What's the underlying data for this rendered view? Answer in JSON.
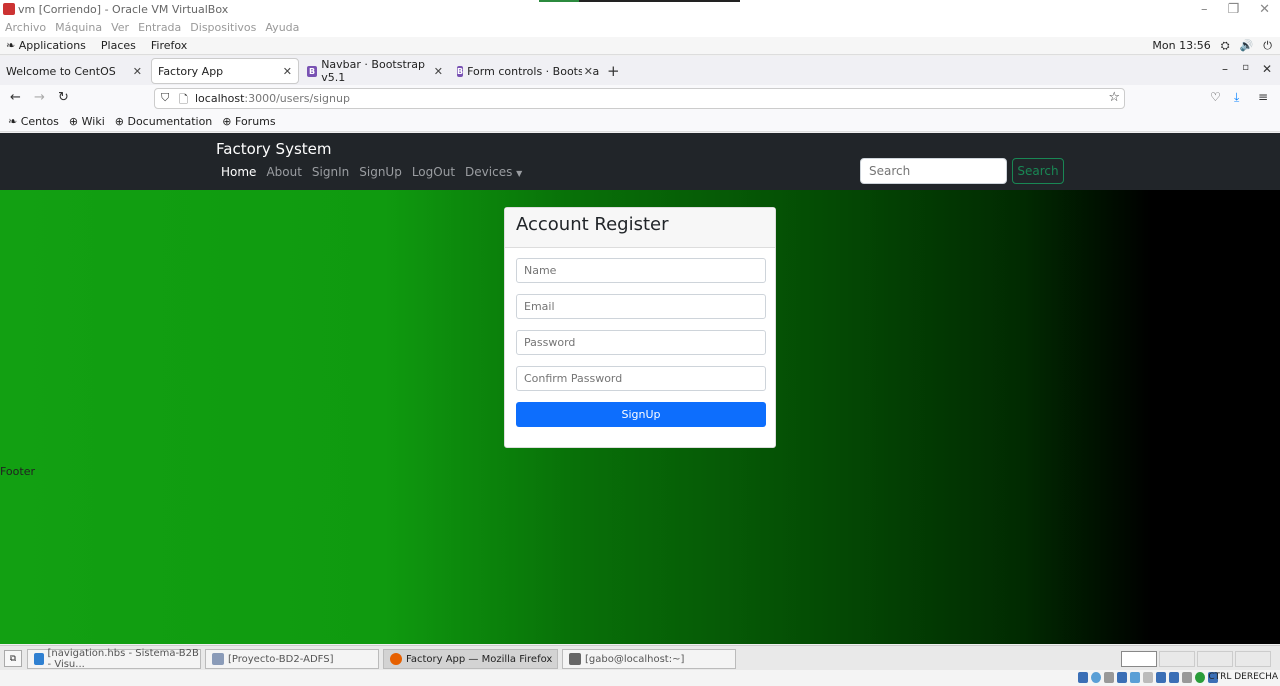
{
  "vbox": {
    "title": "vm [Corriendo] - Oracle VM VirtualBox",
    "menu": [
      "Archivo",
      "Máquina",
      "Ver",
      "Entrada",
      "Dispositivos",
      "Ayuda"
    ]
  },
  "gnome": {
    "applications": "Applications",
    "places": "Places",
    "app": "Firefox",
    "clock": "Mon 13:56"
  },
  "tabs": [
    {
      "label": "Welcome to CentOS"
    },
    {
      "label": "Factory App"
    },
    {
      "label": "Navbar · Bootstrap v5.1"
    },
    {
      "label": "Form controls · Bootstrap"
    }
  ],
  "url": {
    "host": "localhost",
    "path": ":3000/users/signup"
  },
  "bookmarks": [
    "Centos",
    "Wiki",
    "Documentation",
    "Forums"
  ],
  "site": {
    "brand": "Factory System",
    "nav": [
      "Home",
      "About",
      "SignIn",
      "SignUp",
      "LogOut",
      "Devices"
    ],
    "search_placeholder": "Search",
    "search_button": "Search",
    "card_title": "Account Register",
    "fields": {
      "name": "Name",
      "email": "Email",
      "password": "Password",
      "confirm": "Confirm Password"
    },
    "submit": "SignUp",
    "footer": "Footer"
  },
  "taskbar": [
    {
      "label": "[navigation.hbs - Sistema-B2B - Visu..."
    },
    {
      "label": "[Proyecto-BD2-ADFS]"
    },
    {
      "label": "Factory App — Mozilla Firefox"
    },
    {
      "label": "[gabo@localhost:~]"
    }
  ],
  "hostkey": "CTRL DERECHA"
}
